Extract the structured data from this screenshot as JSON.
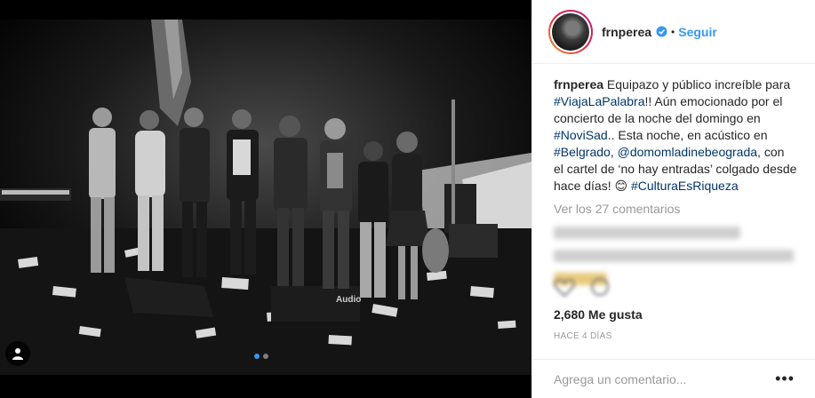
{
  "post": {
    "username": "frnperea",
    "follow_label": "Seguir",
    "bullet": "•",
    "caption": {
      "segments": [
        {
          "text": "Equipazo y público increíble para ",
          "link": false
        },
        {
          "text": "#ViajaLaPalabra",
          "link": true
        },
        {
          "text": "!! Aún emocionado por el concierto de la noche del domingo en ",
          "link": false
        },
        {
          "text": "#NoviSad",
          "link": true
        },
        {
          "text": ".. Esta noche, en acústico en ",
          "link": false
        },
        {
          "text": "#Belgrado",
          "link": true
        },
        {
          "text": ", ",
          "link": false
        },
        {
          "text": "@domomladinebeograda",
          "link": true
        },
        {
          "text": ", con el cartel de ‘no hay entradas’ colgado desde hace días! 😊 ",
          "link": false
        },
        {
          "text": "#CulturaEsRiqueza",
          "link": true
        }
      ]
    },
    "view_comments": "Ver los 27 comentarios",
    "likes": "2,680 Me gusta",
    "time": "HACE 4 DÍAS",
    "comment_placeholder": "Agrega un comentario...",
    "more_label": "•••",
    "photo_mark": "Audio"
  },
  "colors": {
    "link": "#003569",
    "follow": "#3897f0",
    "verified": "#3897f0",
    "muted": "#999999"
  },
  "icons": [
    "verified-badge-icon",
    "user-tag-icon",
    "heart-icon",
    "comment-icon",
    "more-options-icon"
  ]
}
